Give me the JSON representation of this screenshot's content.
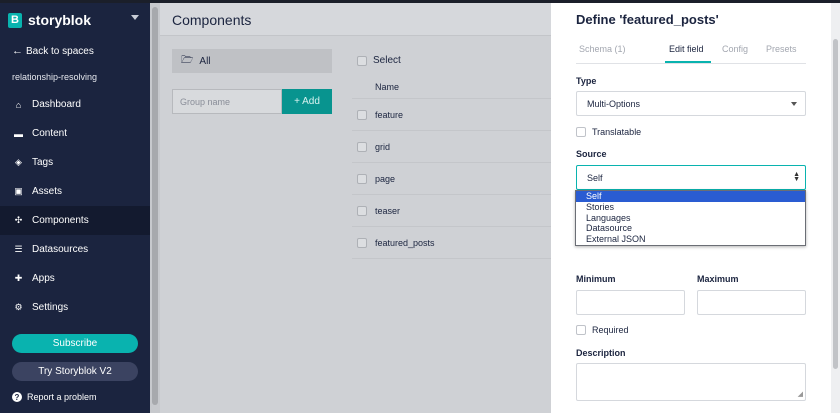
{
  "brand": {
    "logo_letter": "B",
    "name": "storyblok"
  },
  "sidebar": {
    "back_label": "Back to spaces",
    "space_name": "relationship-resolving",
    "items": [
      {
        "label": "Dashboard",
        "icon": "home-icon"
      },
      {
        "label": "Content",
        "icon": "folder-icon"
      },
      {
        "label": "Tags",
        "icon": "tags-icon"
      },
      {
        "label": "Assets",
        "icon": "image-icon"
      },
      {
        "label": "Components",
        "icon": "components-icon",
        "active": true
      },
      {
        "label": "Datasources",
        "icon": "database-icon"
      },
      {
        "label": "Apps",
        "icon": "puzzle-icon"
      },
      {
        "label": "Settings",
        "icon": "gear-icon"
      }
    ],
    "subscribe_label": "Subscribe",
    "try_label": "Try Storyblok V2",
    "report_label": "Report a problem"
  },
  "main": {
    "title": "Components",
    "folder_label": "All",
    "group_placeholder": "Group name",
    "add_label": "+ Add",
    "select_label": "Select",
    "column_name": "Name",
    "rows": [
      "feature",
      "grid",
      "page",
      "teaser",
      "featured_posts"
    ]
  },
  "panel": {
    "title": "Define 'featured_posts'",
    "tabs": [
      "Schema (1)",
      "Edit field",
      "Config",
      "Presets"
    ],
    "active_tab": "Edit field",
    "type_label": "Type",
    "type_value": "Multi-Options",
    "translatable_label": "Translatable",
    "source_label": "Source",
    "source_value": "Self",
    "source_options": [
      "Self",
      "Stories",
      "Languages",
      "Datasource",
      "External JSON"
    ],
    "minimum_label": "Minimum",
    "maximum_label": "Maximum",
    "required_label": "Required",
    "description_label": "Description"
  },
  "colors": {
    "sidebar_bg": "#1b243f",
    "accent": "#09b3af",
    "selected_option": "#2a5cd2"
  }
}
